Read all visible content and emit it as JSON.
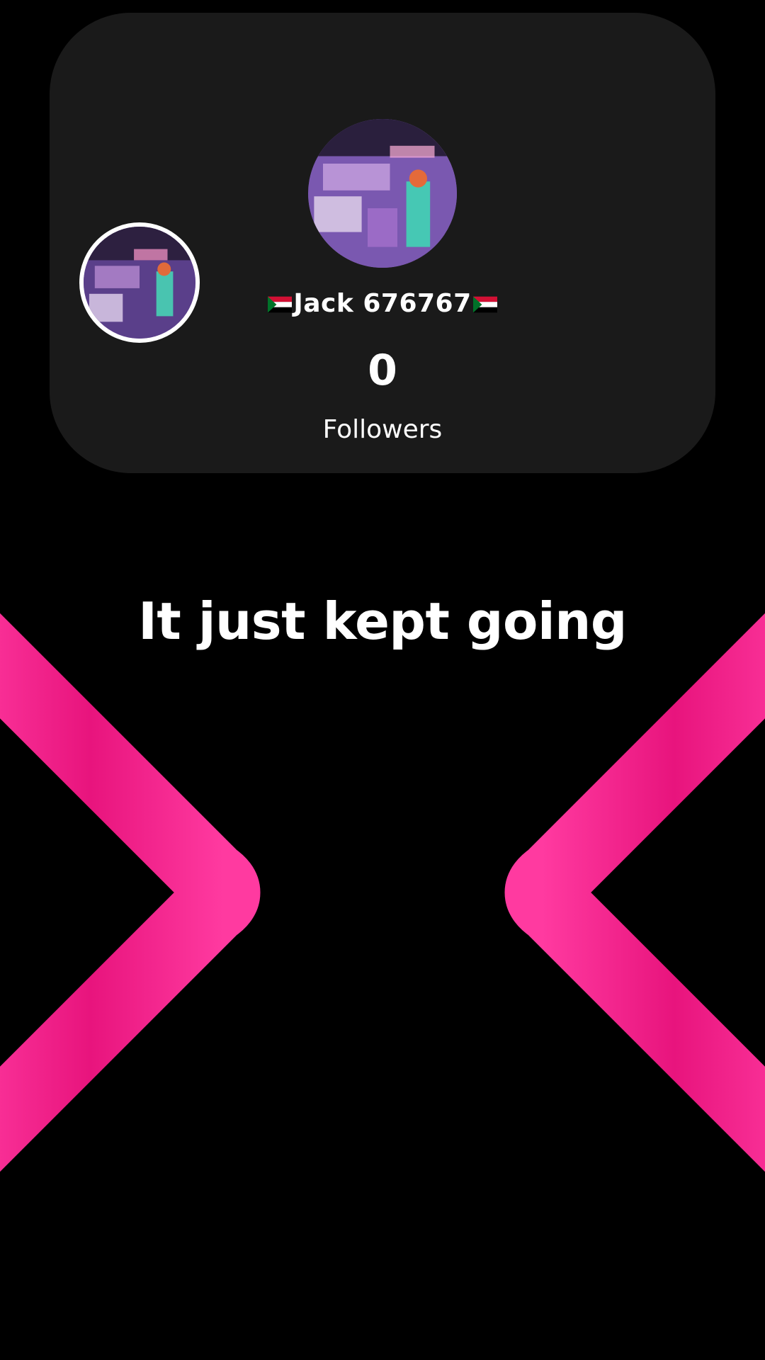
{
  "profile": {
    "username": "Jack 676767",
    "flag_icon": "sudan-flag-icon",
    "followers_count": "0",
    "followers_label": "Followers"
  },
  "caption": "It just kept going",
  "colors": {
    "background": "#000000",
    "card": "#1a1a1a",
    "accent": "#ff1f8e",
    "text": "#ffffff"
  }
}
